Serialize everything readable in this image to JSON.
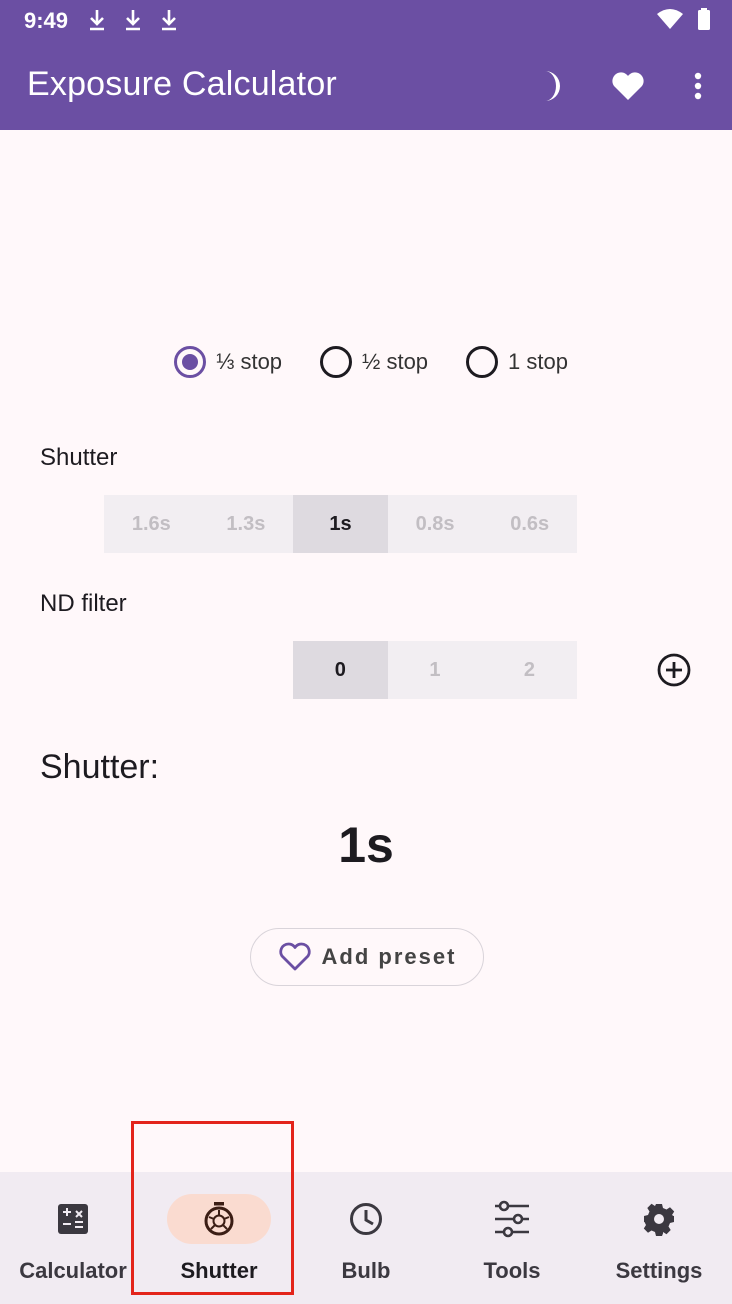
{
  "status_bar": {
    "time": "9:49",
    "download_icons": [
      "download-icon",
      "download-icon",
      "download-icon"
    ],
    "right_icons": [
      "wifi-icon",
      "battery-icon"
    ]
  },
  "app_bar": {
    "title": "Exposure Calculator",
    "actions": [
      "moon-icon",
      "heart-icon",
      "more-vert-icon"
    ]
  },
  "stop_options": [
    {
      "label": "⅓ stop",
      "selected": true
    },
    {
      "label": "½ stop",
      "selected": false
    },
    {
      "label": "1 stop",
      "selected": false
    }
  ],
  "shutter": {
    "label": "Shutter",
    "values": [
      "1.6s",
      "1.3s",
      "1s",
      "0.8s",
      "0.6s"
    ],
    "selected": "1s"
  },
  "nd_filter": {
    "label": "ND filter",
    "values": [
      "0",
      "1",
      "2"
    ],
    "selected": "0",
    "add_icon": "add-circle-icon"
  },
  "result": {
    "label": "Shutter:",
    "value": "1s"
  },
  "preset_button": {
    "label": "Add preset",
    "icon": "heart-outline-icon"
  },
  "bottom_nav": [
    {
      "label": "Calculator",
      "icon": "calculator-icon",
      "active": false
    },
    {
      "label": "Shutter",
      "icon": "shutter-timer-icon",
      "active": true
    },
    {
      "label": "Bulb",
      "icon": "clock-icon",
      "active": false
    },
    {
      "label": "Tools",
      "icon": "tune-icon",
      "active": false
    },
    {
      "label": "Settings",
      "icon": "gear-icon",
      "active": false
    }
  ],
  "colors": {
    "primary": "#6b4fa3",
    "active_nav_pill": "#fadbd0",
    "highlight_box": "#e3241b"
  }
}
